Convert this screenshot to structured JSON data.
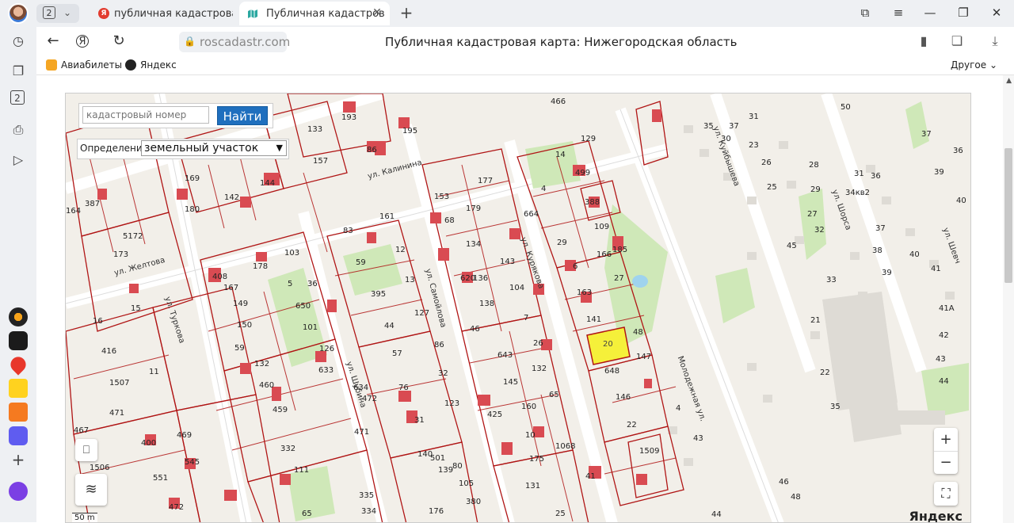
{
  "browser": {
    "tab_count": "2",
    "tabs": [
      {
        "title": "публичная кадастровая к",
        "active": false
      },
      {
        "title": "Публичная кадастрова",
        "active": true
      }
    ],
    "url": "roscadastr.com",
    "page_title": "Публичная кадастровая карта: Нижегородская область",
    "bookmarks": [
      {
        "label": "Авиабилеты",
        "icon": "plane-icon"
      },
      {
        "label": "Яндекс",
        "icon": "yandex-icon"
      }
    ],
    "other_bookmarks": "Другое"
  },
  "page": {
    "search_placeholder": "кадастровый номер",
    "find_label": "Найти",
    "definition_label": "Определение:",
    "definition_value": "земельный участок",
    "zoom_in": "+",
    "zoom_out": "−",
    "yandex_logo": "Яндекс",
    "scale_label": "50 m"
  },
  "map": {
    "highlight_color": "#f5f03a",
    "boundary_color": "#b01515",
    "streets": [
      "ул. Калинина",
      "ул. Самойлова",
      "ул. Курякова",
      "ул. Желтова",
      "ул. Туркова",
      "ул. Шубина",
      "Молодежная ул.",
      "ул. Куйбышева",
      "ул. Шорса",
      "ул. Шевч"
    ],
    "selected_parcel": "20",
    "parcels": [
      "14",
      "499",
      "388",
      "109",
      "185",
      "166",
      "27",
      "6",
      "163",
      "141",
      "48",
      "147",
      "648",
      "146",
      "4",
      "664",
      "29",
      "129",
      "177",
      "153",
      "179",
      "68",
      "134",
      "620",
      "136",
      "143",
      "104",
      "138",
      "7",
      "46",
      "643",
      "26",
      "132",
      "65",
      "145",
      "160",
      "425",
      "10",
      "175",
      "1068",
      "131",
      "41",
      "25",
      "380",
      "83",
      "161",
      "59",
      "12",
      "13",
      "395",
      "127",
      "44",
      "57",
      "86",
      "32",
      "76",
      "123",
      "31",
      "501",
      "140",
      "139",
      "80",
      "105",
      "176",
      "103",
      "178",
      "408",
      "167",
      "5",
      "36",
      "650",
      "149",
      "150",
      "101",
      "126",
      "59",
      "633",
      "132",
      "460",
      "634",
      "472",
      "459",
      "471",
      "332",
      "111",
      "335",
      "334",
      "65",
      "133",
      "193",
      "195",
      "157",
      "86",
      "169",
      "142",
      "144",
      "180",
      "387",
      "164",
      "5172",
      "173",
      "16",
      "15",
      "416",
      "1507",
      "11",
      "471",
      "400",
      "469",
      "467",
      "1506",
      "551",
      "545",
      "472",
      "1509",
      "466",
      "22",
      "4",
      "43",
      "44",
      "46",
      "48",
      "50",
      "35",
      "37",
      "31",
      "30",
      "23",
      "26",
      "25",
      "28",
      "29",
      "27",
      "32",
      "33",
      "31",
      "34кв2",
      "36",
      "37",
      "38",
      "39",
      "40",
      "41",
      "41А",
      "42",
      "43",
      "44",
      "45",
      "21",
      "22",
      "35",
      "36",
      "37",
      "39",
      "40"
    ]
  }
}
